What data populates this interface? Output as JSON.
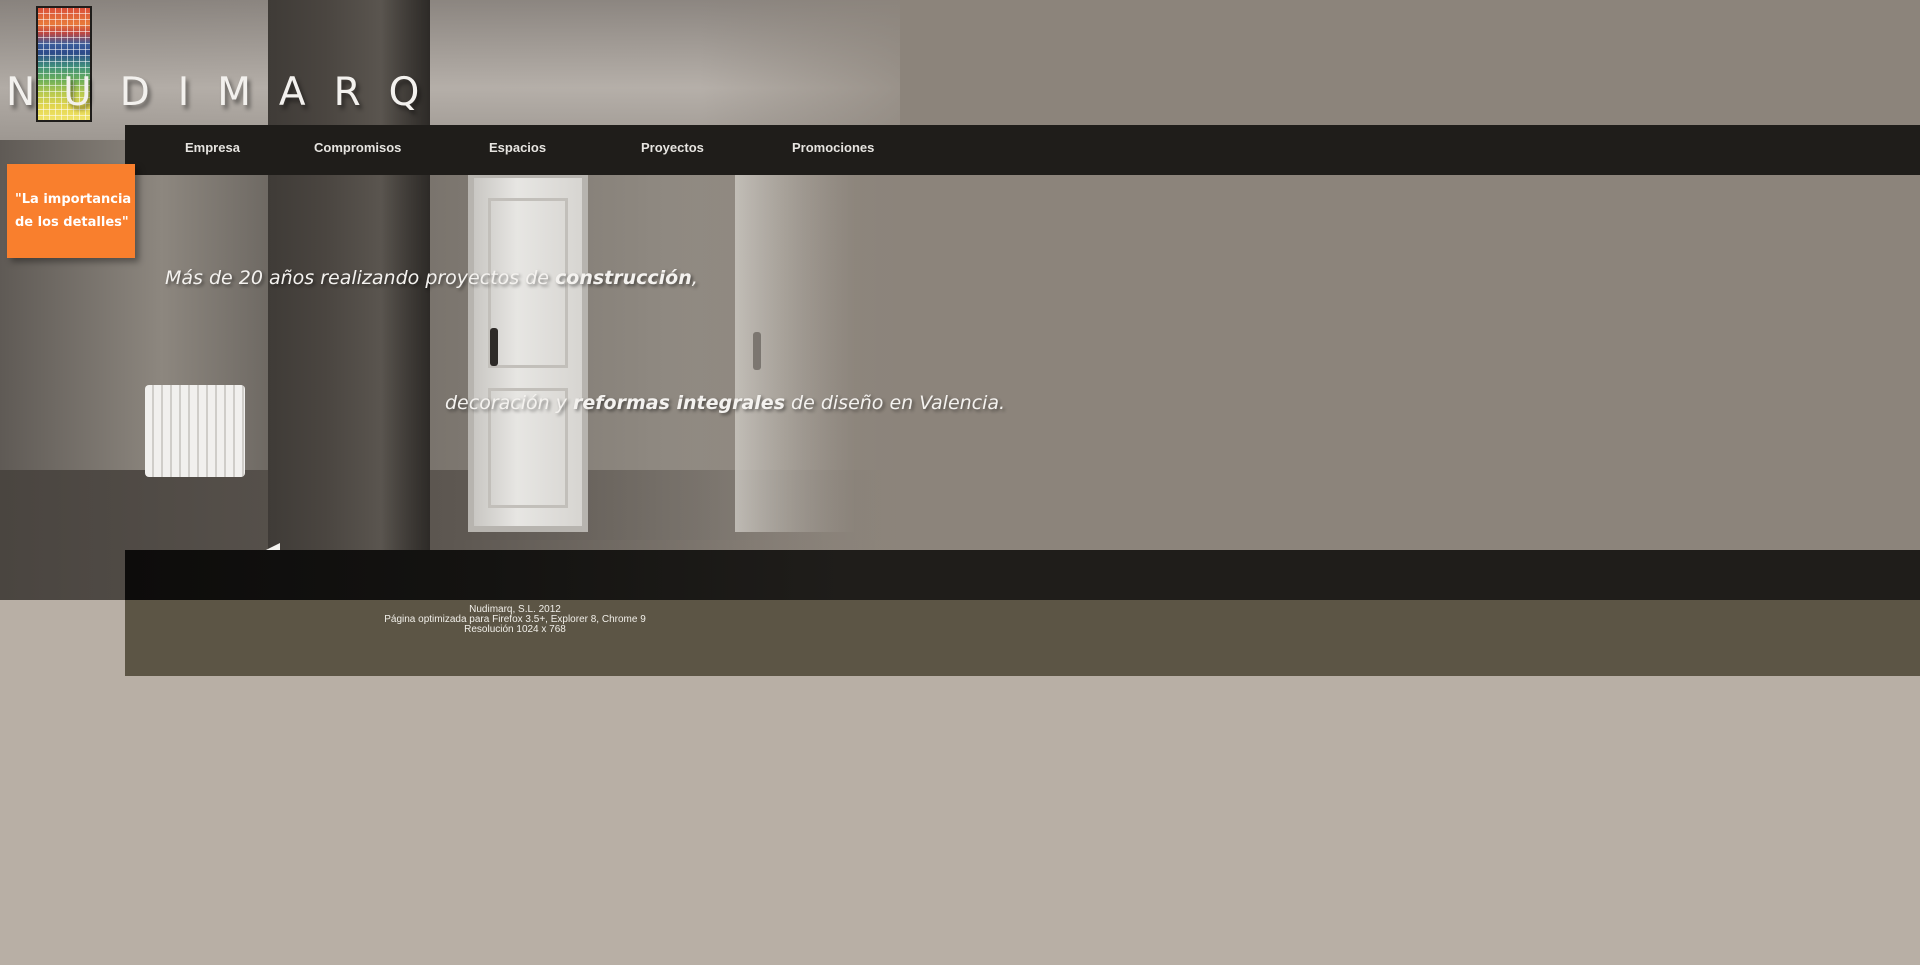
{
  "brand": {
    "name": "NUDIMARQ"
  },
  "nav": {
    "items": [
      {
        "label": "Empresa"
      },
      {
        "label": "Compromisos"
      },
      {
        "label": "Espacios"
      },
      {
        "label": "Proyectos"
      },
      {
        "label": "Promociones"
      }
    ]
  },
  "slogan": {
    "line1": "\"La importancia",
    "line2": "de los detalles\""
  },
  "hero": {
    "line1_before": "Más de 20 años realizando proyectos de ",
    "line1_bold": "construcción",
    "line1_after": ",",
    "line2_a": "decoración y ",
    "line2_bold": "reformas integrales",
    "line2_b": " de diseño en Valencia."
  },
  "footer": {
    "line1": "Nudimarq, S.L. 2012",
    "line2": "Página optimizada para Firefox 3.5+, Explorer 8, Chrome 9",
    "line3": "Resolución 1024 x 768"
  }
}
